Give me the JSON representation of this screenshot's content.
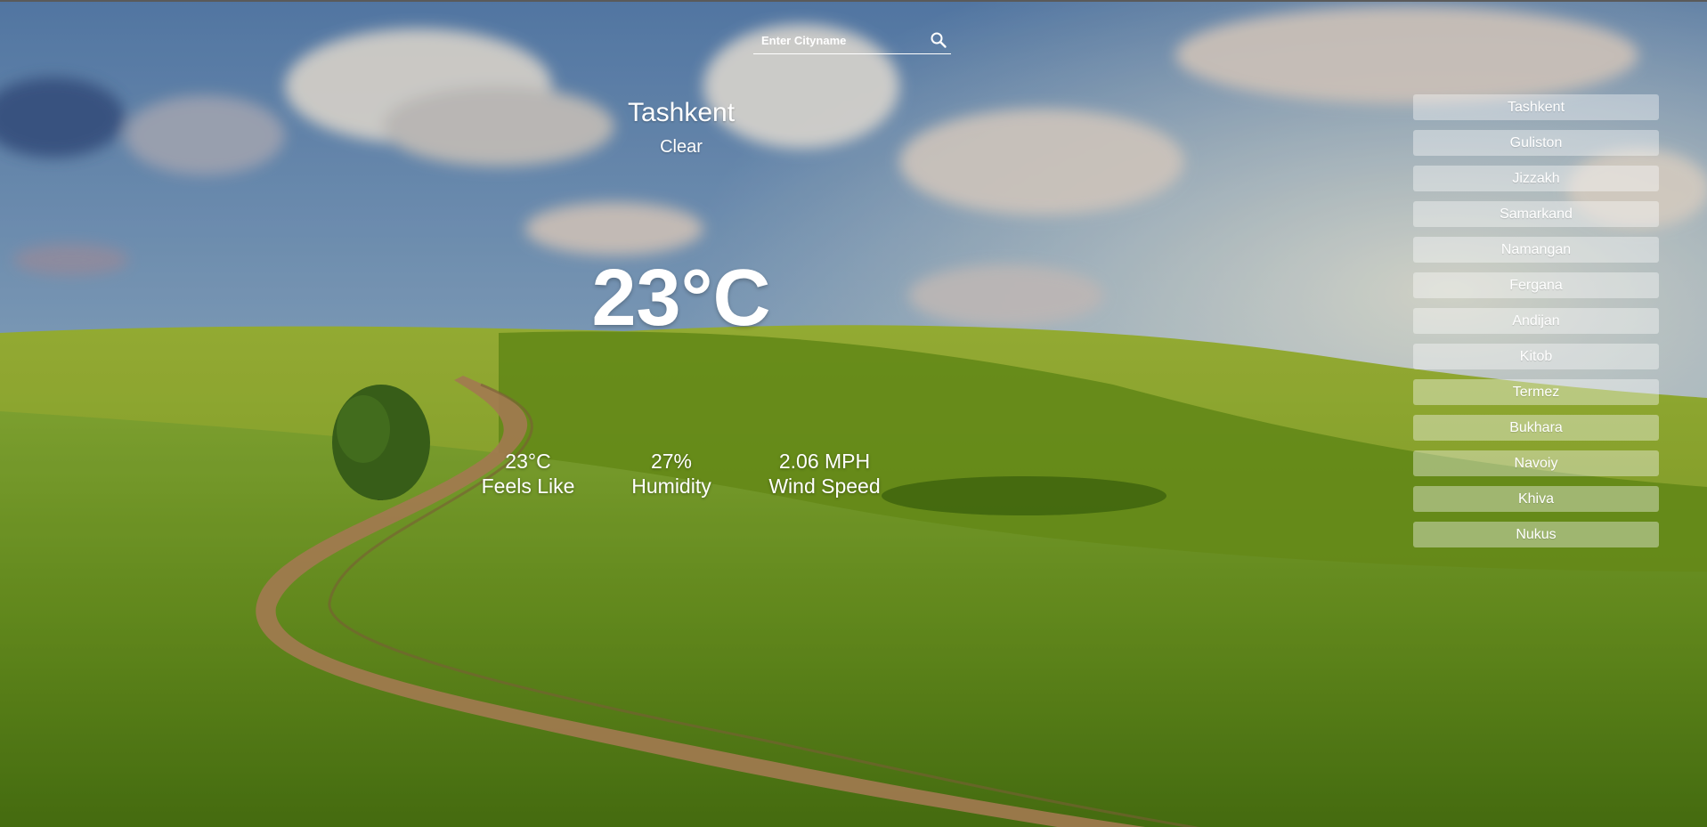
{
  "search": {
    "placeholder": "Enter Cityname",
    "icon": "search-icon"
  },
  "weather": {
    "city": "Tashkent",
    "condition": "Clear",
    "temperature": "23°C",
    "stats": [
      {
        "value": "23°C",
        "label": "Feels Like"
      },
      {
        "value": "27%",
        "label": "Humidity"
      },
      {
        "value": "2.06 MPH",
        "label": "Wind Speed"
      }
    ]
  },
  "cities": [
    "Tashkent",
    "Guliston",
    "Jizzakh",
    "Samarkand",
    "Namangan",
    "Fergana",
    "Andijan",
    "Kitob",
    "Termez",
    "Bukhara",
    "Navoiy",
    "Khiva",
    "Nukus"
  ],
  "colors": {
    "text": "#ffffff",
    "sky_top": "#6a92c2",
    "grass": "#7da62a",
    "button_bg": "rgba(255,255,255,0.38)"
  }
}
